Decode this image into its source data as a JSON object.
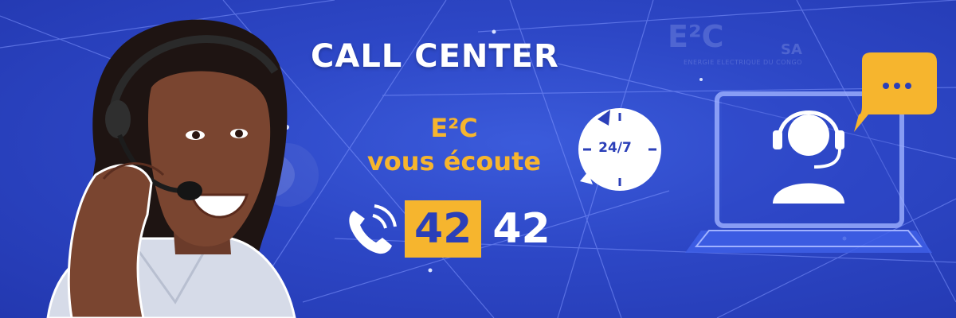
{
  "banner": {
    "headline": "CALL CENTER",
    "subtitle_line1": "E²C",
    "subtitle_line2": "vous écoute",
    "phone_part1": "42",
    "phone_part2": "42",
    "availability": "24/7",
    "logo_text": "E²C",
    "logo_suffix": "SA",
    "logo_tagline": "ENERGIE ELECTRIQUE DU CONGO"
  },
  "icons": {
    "phone": "phone-ringing-icon",
    "clock": "clock-24-7-icon",
    "agent": "headset-agent-icon",
    "chat": "chat-bubble-icon"
  },
  "colors": {
    "background": "#2f45c8",
    "accent": "#f6b52e",
    "text": "#ffffff",
    "number_text": "#2b3fb8"
  }
}
